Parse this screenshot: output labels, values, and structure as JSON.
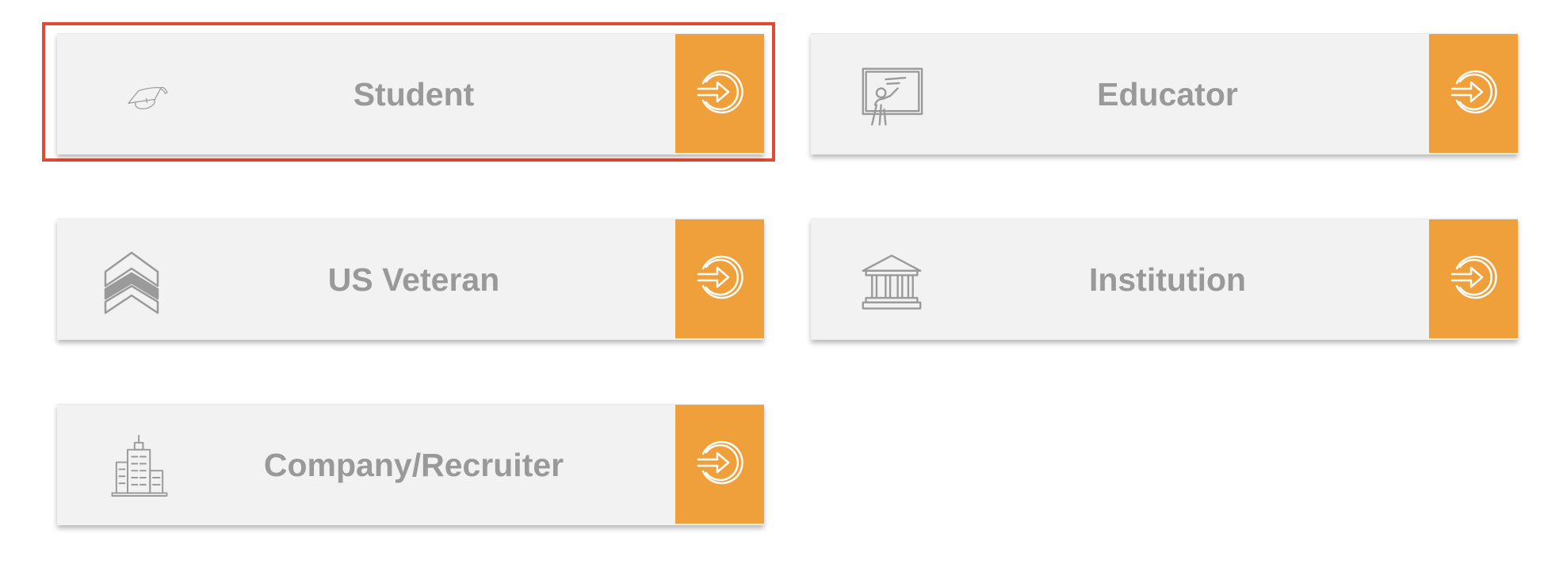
{
  "colors": {
    "card_background": "#f2f2f2",
    "label_text": "#999999",
    "arrow_background": "#f0a03b",
    "arrow_icon": "#ffffff",
    "selection_border": "#e04a32",
    "icon_stroke": "#9a9a9a"
  },
  "selected_card": "student",
  "cards": {
    "student": {
      "label": "Student",
      "icon": "graduation-cap-icon",
      "arrow_icon": "sign-in-arrow-icon"
    },
    "educator": {
      "label": "Educator",
      "icon": "teacher-board-icon",
      "arrow_icon": "sign-in-arrow-icon"
    },
    "us_veteran": {
      "label": "US Veteran",
      "icon": "chevron-rank-icon",
      "arrow_icon": "sign-in-arrow-icon"
    },
    "institution": {
      "label": "Institution",
      "icon": "institution-building-icon",
      "arrow_icon": "sign-in-arrow-icon"
    },
    "company_recruiter": {
      "label": "Company/Recruiter",
      "icon": "office-building-icon",
      "arrow_icon": "sign-in-arrow-icon"
    }
  }
}
